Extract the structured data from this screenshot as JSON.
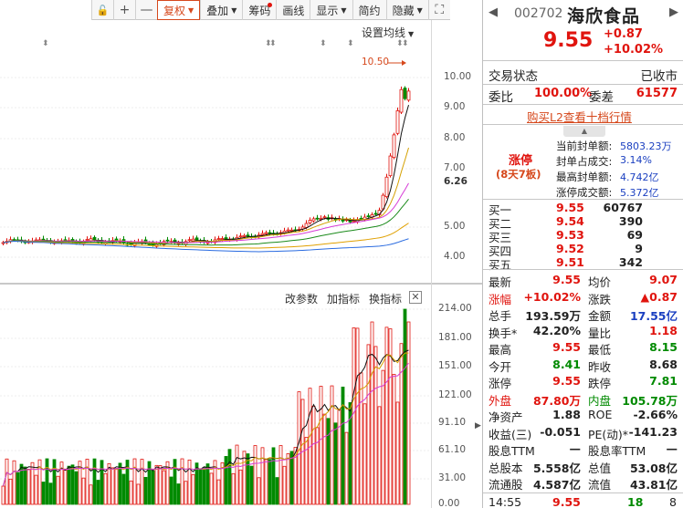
{
  "toolbar": {
    "items": [
      {
        "label": "",
        "icon": "lock-icon",
        "name": "lock-button"
      },
      {
        "label": "+",
        "name": "zoom-in-button"
      },
      {
        "label": "—",
        "name": "zoom-out-button"
      },
      {
        "label": "复权",
        "name": "fuquan-button",
        "active": true,
        "dropdown": true
      },
      {
        "label": "叠加",
        "name": "overlay-button",
        "dropdown": true
      },
      {
        "label": "筹码",
        "name": "chips-button",
        "dot": true
      },
      {
        "label": "画线",
        "name": "draw-line-button"
      },
      {
        "label": "显示",
        "name": "display-button",
        "dropdown": true
      },
      {
        "label": "简约",
        "name": "simple-button"
      },
      {
        "label": "隐藏",
        "name": "hide-button",
        "dropdown": true
      },
      {
        "label": "",
        "icon": "fullscreen-icon",
        "name": "fullscreen-button"
      }
    ]
  },
  "price_chart": {
    "ma_settings_label": "设置均线",
    "peak_label": "10.50",
    "y_ticks": [
      "10.00",
      "9.00",
      "8.00",
      "7.00",
      "6.26",
      "5.00",
      "4.00"
    ],
    "highlight_tick": "6.26"
  },
  "volume_chart": {
    "buttons": [
      "改参数",
      "加指标",
      "换指标"
    ],
    "y_ticks": [
      "214.00",
      "181.00",
      "151.00",
      "121.00",
      "91.10",
      "61.10",
      "31.00",
      "0.00"
    ]
  },
  "stock": {
    "code": "002702",
    "name": "海欣食品",
    "price": "9.55",
    "change": "+0.87",
    "change_pct": "+10.02%"
  },
  "status": {
    "label": "交易状态",
    "value": "已收市",
    "weibi_label": "委比",
    "weibi_value": "100.00%",
    "weicha_label": "委差",
    "weicha_value": "61577",
    "l2_link": "购买L2查看十档行情"
  },
  "limit_up": {
    "title": "涨停",
    "sub": "(8天7板)",
    "items": [
      {
        "label": "当前封单额:",
        "value": "5803.23万"
      },
      {
        "label": "封单占成交:",
        "value": "3.14%"
      },
      {
        "label": "最高封单额:",
        "value": "4.742亿"
      },
      {
        "label": "涨停成交额:",
        "value": "5.372亿"
      }
    ]
  },
  "bids": [
    {
      "label": "买一",
      "price": "9.55",
      "vol": "60767"
    },
    {
      "label": "买二",
      "price": "9.54",
      "vol": "390"
    },
    {
      "label": "买三",
      "price": "9.53",
      "vol": "69"
    },
    {
      "label": "买四",
      "price": "9.52",
      "vol": "9"
    },
    {
      "label": "买五",
      "price": "9.51",
      "vol": "342"
    }
  ],
  "stats": [
    {
      "l1": "最新",
      "v1": "9.55",
      "c1": "red",
      "l2": "均价",
      "v2": "9.07",
      "c2": "red"
    },
    {
      "l1": "涨幅",
      "v1": "+10.02%",
      "c1": "red",
      "l2": "涨跌",
      "v2": "▲0.87",
      "c2": "red",
      "lc": "red"
    },
    {
      "l1": "总手",
      "v1": "193.59万",
      "c1": "dark",
      "l2": "金额",
      "v2": "17.55亿",
      "c2": "blue"
    },
    {
      "l1": "换手*",
      "v1": "42.20%",
      "c1": "dark",
      "l2": "量比",
      "v2": "1.18",
      "c2": "red"
    },
    {
      "l1": "最高",
      "v1": "9.55",
      "c1": "red",
      "l2": "最低",
      "v2": "8.15",
      "c2": "green"
    },
    {
      "l1": "今开",
      "v1": "8.41",
      "c1": "green",
      "l2": "昨收",
      "v2": "8.68",
      "c2": "dark"
    },
    {
      "l1": "涨停",
      "v1": "9.55",
      "c1": "red",
      "l2": "跌停",
      "v2": "7.81",
      "c2": "green"
    },
    {
      "l1": "外盘",
      "v1": "87.80万",
      "c1": "red",
      "l2": "内盘",
      "v2": "105.78万",
      "c2": "green",
      "lc": "red",
      "lc2": "green"
    },
    {
      "l1": "净资产",
      "v1": "1.88",
      "c1": "dark",
      "l2": "ROE",
      "v2": "-2.66%",
      "c2": "dark"
    },
    {
      "l1": "收益(三)",
      "v1": "-0.051",
      "c1": "dark",
      "l2": "PE(动)*",
      "v2": "-141.23",
      "c2": "dark"
    },
    {
      "l1": "股息TTM",
      "v1": "—",
      "c1": "dark",
      "l2": "股息率TTM",
      "v2": "—",
      "c2": "dark"
    },
    {
      "l1": "总股本",
      "v1": "5.558亿",
      "c1": "dark",
      "l2": "总值",
      "v2": "53.08亿",
      "c2": "dark"
    },
    {
      "l1": "流通股",
      "v1": "4.587亿",
      "c1": "dark",
      "l2": "流值",
      "v2": "43.81亿",
      "c2": "dark"
    }
  ],
  "tick": {
    "time": "14:55",
    "price": "9.55",
    "vol": "18",
    "num": "8"
  },
  "colors": {
    "up": "#e0140e",
    "down": "#008a00",
    "accent": "#d6481c"
  }
}
